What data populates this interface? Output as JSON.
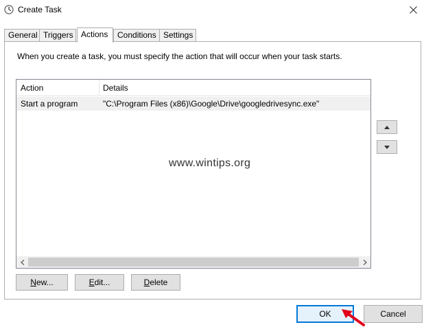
{
  "window": {
    "title": "Create Task",
    "icon": "clock-icon"
  },
  "tabs": [
    {
      "label": "General",
      "active": false
    },
    {
      "label": "Triggers",
      "active": false
    },
    {
      "label": "Actions",
      "active": true
    },
    {
      "label": "Conditions",
      "active": false
    },
    {
      "label": "Settings",
      "active": false
    }
  ],
  "actions_panel": {
    "intro": "When you create a task, you must specify the action that will occur when your task starts.",
    "columns": [
      "Action",
      "Details"
    ],
    "rows": [
      {
        "action": "Start a program",
        "details": "\"C:\\Program Files (x86)\\Google\\Drive\\googledrivesync.exe\""
      }
    ],
    "buttons": {
      "new_label": "New...",
      "new_mnemonic": "N",
      "new_rest": "ew...",
      "edit_label": "Edit...",
      "edit_mnemonic": "E",
      "edit_rest": "dit...",
      "delete_label": "Delete",
      "delete_mnemonic": "D",
      "delete_rest": "elete"
    }
  },
  "watermark": "www.wintips.org",
  "dialog": {
    "ok_label": "OK",
    "cancel_label": "Cancel"
  },
  "colors": {
    "accent": "#0078d7",
    "arrow": "#e2001a"
  }
}
